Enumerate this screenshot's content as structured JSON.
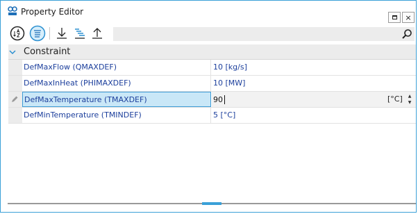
{
  "window": {
    "title": "Property Editor",
    "close_label": "×",
    "app_icon": "app-logo-icon"
  },
  "toolbar": {
    "buttons": [
      {
        "name": "sort-alphabetical",
        "icon": "sort-az-icon"
      },
      {
        "name": "categorized",
        "icon": "categorized-list-icon",
        "active": true
      },
      {
        "name": "expand-all",
        "icon": "arrow-down-icon"
      },
      {
        "name": "hierarchy",
        "icon": "hierarchy-icon"
      },
      {
        "name": "collapse-all",
        "icon": "arrow-up-icon"
      }
    ],
    "search": {
      "value": "",
      "placeholder": "",
      "icon": "search-icon"
    }
  },
  "grid": {
    "category": {
      "label": "Constraint",
      "expanded": true
    },
    "rows": [
      {
        "name": "DefMaxFlow (QMAXDEF)",
        "value": "10 [kg/s]"
      },
      {
        "name": "DefMaxInHeat (PHIMAXDEF)",
        "value": "10 [MW]"
      },
      {
        "name": "DefMaxTemperature (TMAXDEF)",
        "value": "90",
        "unit": "[°C]",
        "editing": true
      },
      {
        "name": "DefMinTemperature (TMINDEF)",
        "value": "5 [°C]"
      }
    ]
  },
  "colors": {
    "accent": "#3aa0d8",
    "property_text": "#1c3f9c",
    "selected_bg": "#c9e7f7"
  }
}
